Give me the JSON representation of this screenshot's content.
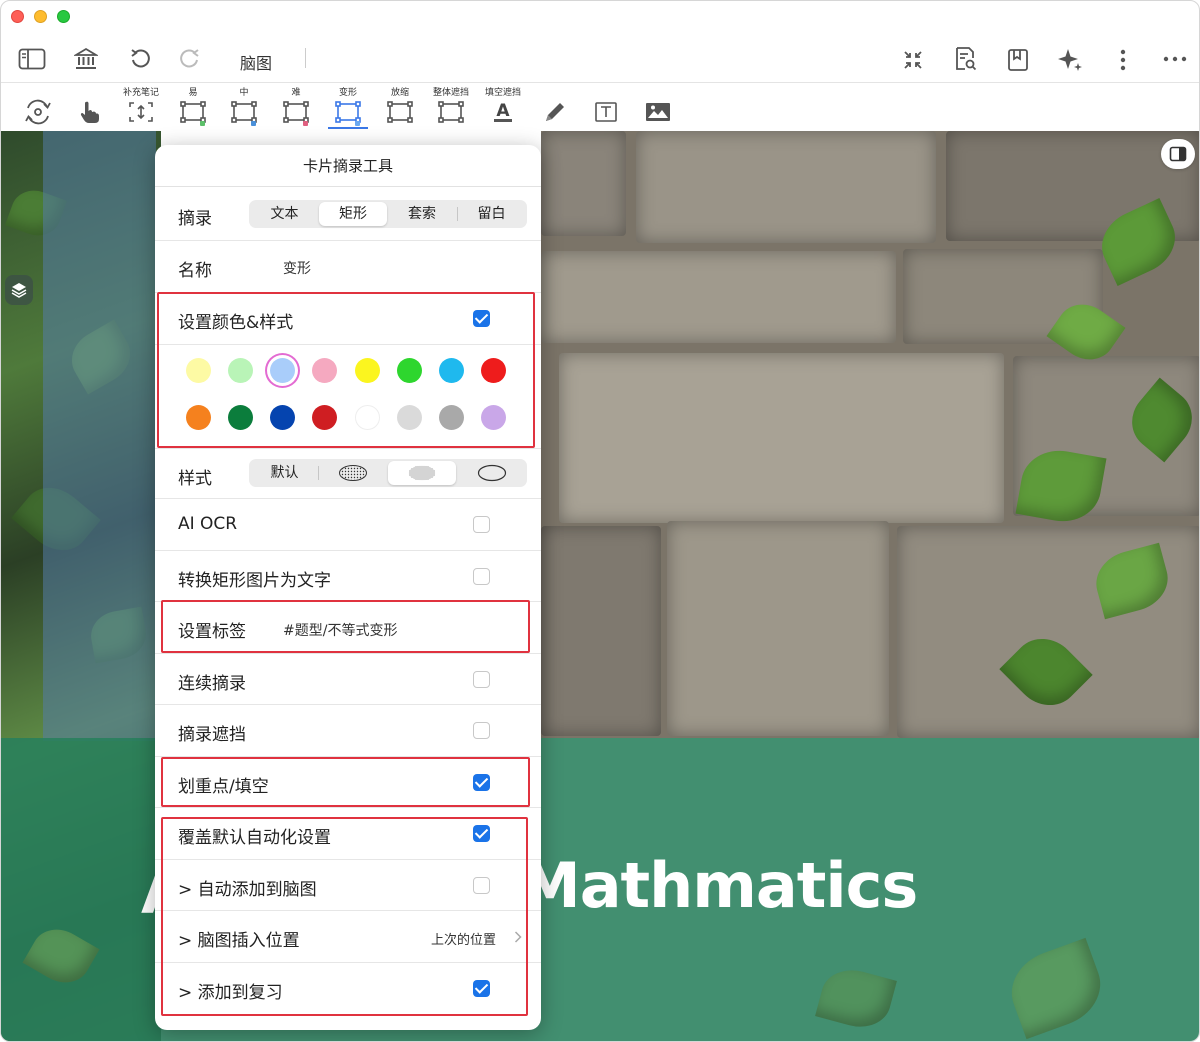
{
  "toolbar_top": {
    "mindmap_label": "脑图",
    "icons": [
      "sidebar-toggle-icon",
      "library-icon",
      "undo-icon",
      "redo-icon",
      "collapse-icon",
      "search-document-icon",
      "bookmark-icon",
      "sparkle-icon",
      "more-vertical-icon",
      "more-horizontal-icon"
    ]
  },
  "toolbar_tools": [
    {
      "label": "",
      "icon": "rotate-settings-icon"
    },
    {
      "label": "",
      "icon": "pointer-hand-icon"
    },
    {
      "label": "补充笔记",
      "icon": "add-note-icon"
    },
    {
      "label": "易",
      "icon": "rect-easy-icon",
      "dot": "#5cc06a"
    },
    {
      "label": "中",
      "icon": "rect-medium-icon",
      "dot": "#4a90d9"
    },
    {
      "label": "难",
      "icon": "rect-hard-icon",
      "dot": "#e06080"
    },
    {
      "label": "变形",
      "icon": "rect-transform-icon",
      "dot": "#6aa8f0",
      "selected": true
    },
    {
      "label": "放缩",
      "icon": "rect-scale-icon"
    },
    {
      "label": "整体遮挡",
      "icon": "rect-mask-icon"
    },
    {
      "label": "填空遮挡",
      "icon": "text-fill-icon"
    },
    {
      "label": "",
      "icon": "pencil-icon"
    },
    {
      "label": "",
      "icon": "text-box-icon"
    },
    {
      "label": "",
      "icon": "image-icon"
    }
  ],
  "background": {
    "cover_title": "Mathmatics",
    "cover_left_letter": "A"
  },
  "popover": {
    "title": "卡片摘录工具",
    "excerpt": {
      "label": "摘录",
      "options": [
        "文本",
        "矩形",
        "套索",
        "留白"
      ],
      "selected": "矩形"
    },
    "name": {
      "label": "名称",
      "value": "变形"
    },
    "color_style": {
      "label": "设置颜色&样式",
      "checked": true
    },
    "colors": [
      "#fdfaa4",
      "#b9f4b7",
      "#a9cdfa",
      "#f5a9c0",
      "#fbf51f",
      "#2ed62e",
      "#1fb9ee",
      "#ee1c1c",
      "#f5811e",
      "#0b7d3c",
      "#0544af",
      "#cf1e22",
      "#ffffff",
      "#dadada",
      "#a9a9a9",
      "#c9a7e8"
    ],
    "selected_color": "#a9cdfa",
    "style": {
      "label": "样式",
      "options": [
        "默认",
        "dotted-oval",
        "dense-oval",
        "empty-oval"
      ],
      "default_label": "默认",
      "selected_index": 2
    },
    "ai_ocr": {
      "label": "AI OCR",
      "checked": false
    },
    "convert": {
      "label": "转换矩形图片为文字",
      "checked": false
    },
    "tags": {
      "label": "设置标签",
      "value": "#题型/不等式变形"
    },
    "continuous": {
      "label": "连续摘录",
      "checked": false
    },
    "mask": {
      "label": "摘录遮挡",
      "checked": false
    },
    "highlight": {
      "label": "划重点/填空",
      "checked": true
    },
    "override": {
      "label": "覆盖默认自动化设置",
      "checked": true
    },
    "auto_mindmap": {
      "label": "> 自动添加到脑图",
      "checked": false
    },
    "insert_position": {
      "label": "> 脑图插入位置",
      "value": "上次的位置"
    },
    "add_review": {
      "label": "> 添加到复习",
      "checked": true
    }
  }
}
